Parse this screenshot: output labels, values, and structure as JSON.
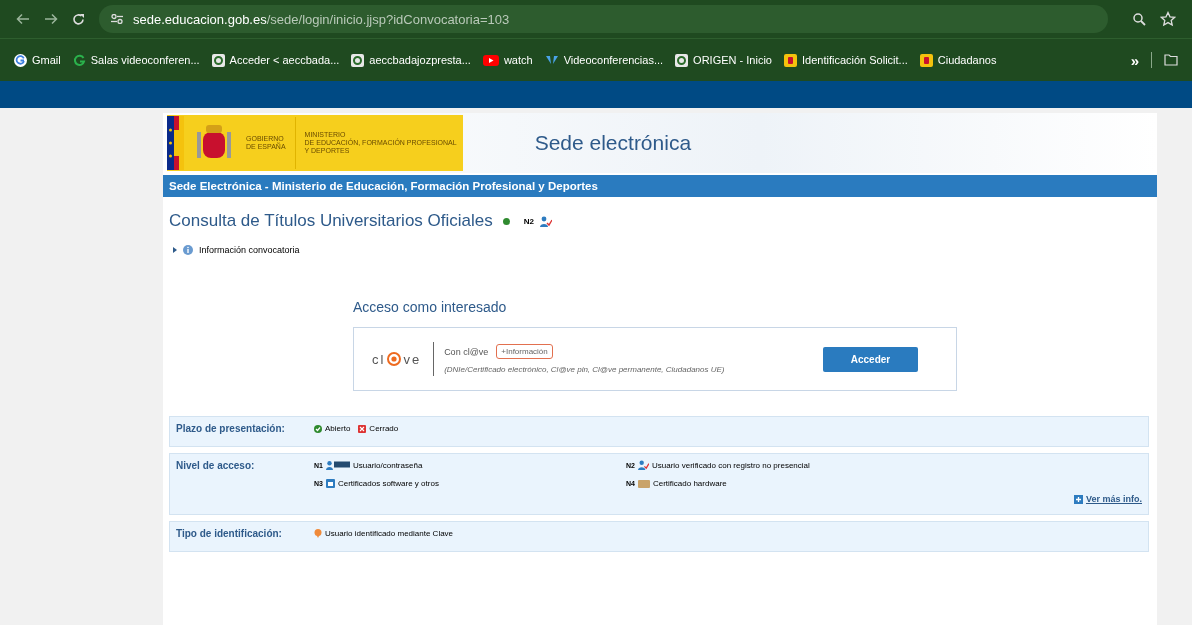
{
  "browser": {
    "url_host": "sede.educacion.gob.es",
    "url_path": "/sede/login/inicio.jjsp?idConvocatoria=103",
    "more": "»",
    "bookmarks": [
      {
        "label": "Gmail",
        "kind": "g"
      },
      {
        "label": "Salas videoconferen...",
        "kind": "ring"
      },
      {
        "label": "Acceder < aeccbada...",
        "kind": "square"
      },
      {
        "label": "aeccbadajozpresta...",
        "kind": "square"
      },
      {
        "label": "watch",
        "kind": "video"
      },
      {
        "label": "Videoconferencias...",
        "kind": "wings"
      },
      {
        "label": "ORIGEN - Inicio",
        "kind": "square"
      },
      {
        "label": "Identificación Solicit...",
        "kind": "crest"
      },
      {
        "label": "Ciudadanos",
        "kind": "crest"
      }
    ]
  },
  "header": {
    "gov_text": "GOBIERNO\nDE ESPAÑA",
    "ministry_text": "MINISTERIO\nDE EDUCACIÓN, FORMACIÓN PROFESIONAL\nY DEPORTES",
    "title": "Sede electrónica"
  },
  "nav_bar": "Sede Electrónica - Ministerio de Educación, Formación Profesional y Deportes",
  "page": {
    "title": "Consulta de Títulos Universitarios Oficiales",
    "open": true,
    "level_badge": "N2",
    "info_link": "Información convocatoria"
  },
  "access": {
    "logo_left": "cl",
    "logo_right": "ve",
    "heading": "Acceso como interesado",
    "method": "Con cl@ve",
    "info_button": "+Información",
    "description": "(DNIe/Certificado electrónico, Cl@ve pin, Cl@ve permanente, Ciudadanos UE)",
    "button": "Acceder"
  },
  "details": [
    {
      "kind": "legend",
      "label": "Plazo de presentación:",
      "items": [
        {
          "kind": "open",
          "text": "Abierto"
        },
        {
          "kind": "closed",
          "text": "Cerrado"
        }
      ]
    },
    {
      "kind": "levels",
      "label": "Nivel de acceso:",
      "more": "Ver más info.",
      "items": [
        {
          "level": "N1",
          "kind": "user-key",
          "text": "Usuario/contraseña"
        },
        {
          "level": "N2",
          "kind": "user-check",
          "text": "Usuario verificado con registro no presencial"
        },
        {
          "level": "N3",
          "kind": "cert",
          "text": "Certificados software y otros"
        },
        {
          "level": "N4",
          "kind": "card",
          "text": "Certificado hardware"
        }
      ]
    },
    {
      "kind": "legend",
      "label": "Tipo de identificación:",
      "items": [
        {
          "kind": "pin",
          "text": "Usuario identificado mediante Clave"
        }
      ]
    }
  ]
}
